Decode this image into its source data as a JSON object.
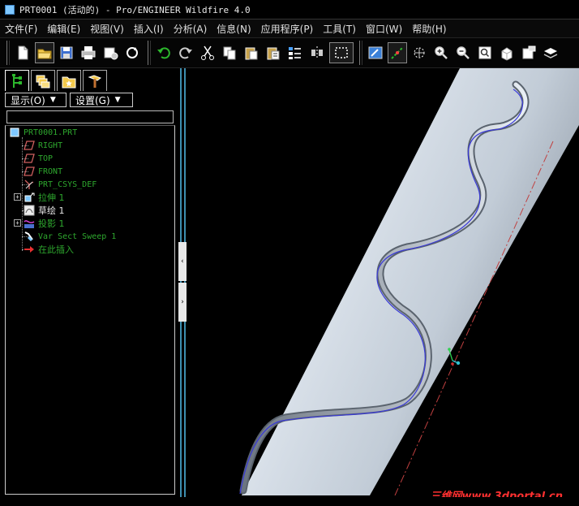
{
  "window": {
    "title": "PRT0001 (活动的) - Pro/ENGINEER Wildfire 4.0"
  },
  "menu": {
    "items": [
      {
        "label": "文件(F)"
      },
      {
        "label": "编辑(E)"
      },
      {
        "label": "视图(V)"
      },
      {
        "label": "插入(I)"
      },
      {
        "label": "分析(A)"
      },
      {
        "label": "信息(N)"
      },
      {
        "label": "应用程序(P)"
      },
      {
        "label": "工具(T)"
      },
      {
        "label": "窗口(W)"
      },
      {
        "label": "帮助(H)"
      }
    ]
  },
  "toolbar": {
    "icons": [
      "new-icon",
      "open-icon",
      "save-icon",
      "print-icon",
      "send-icon",
      "regenerate-icon",
      "undo-icon",
      "redo-icon",
      "cut-icon",
      "copy-icon",
      "paste-icon",
      "paste-special-icon",
      "regen-manager-icon",
      "mirror-icon",
      "select-box-icon",
      "repaint-icon",
      "spin-center-icon",
      "orient-icon",
      "zoom-in-icon",
      "zoom-out-icon",
      "refit-icon",
      "view-manager-icon",
      "saved-views-icon",
      "layers-icon"
    ]
  },
  "leftpanel": {
    "tabs": [
      "model-tree-icon",
      "layers-tab-icon",
      "favorites-tab-icon",
      "connections-tab-icon"
    ],
    "show_dropdown": "显示(O)",
    "settings_dropdown": "设置(G)",
    "tree": [
      {
        "label": "PRT0001.PRT",
        "icon": "part-icon",
        "level": 0
      },
      {
        "label": "RIGHT",
        "icon": "datum-plane-icon",
        "level": 1
      },
      {
        "label": "TOP",
        "icon": "datum-plane-icon",
        "level": 1
      },
      {
        "label": "FRONT",
        "icon": "datum-plane-icon",
        "level": 1
      },
      {
        "label": "PRT_CSYS_DEF",
        "icon": "csys-icon",
        "level": 1
      },
      {
        "label": "拉伸 1",
        "icon": "extrude-icon",
        "level": 1,
        "expandable": true
      },
      {
        "label": "草绘 1",
        "icon": "sketch-icon",
        "level": 1
      },
      {
        "label": "投影 1",
        "icon": "project-icon",
        "level": 1,
        "expandable": true
      },
      {
        "label": "Var Sect Sweep 1",
        "icon": "var-sweep-icon",
        "level": 1
      },
      {
        "label": "在此插入",
        "icon": "insert-here-icon",
        "level": 1
      }
    ]
  },
  "graphics": {
    "background": "#000000",
    "cylinder_color": "#c4d0dc",
    "curve_color": "#3a3ad8",
    "axis_color": "#c04040"
  },
  "watermark": {
    "text": "三维网www.3dportal.cn",
    "color": "#ff3030"
  }
}
